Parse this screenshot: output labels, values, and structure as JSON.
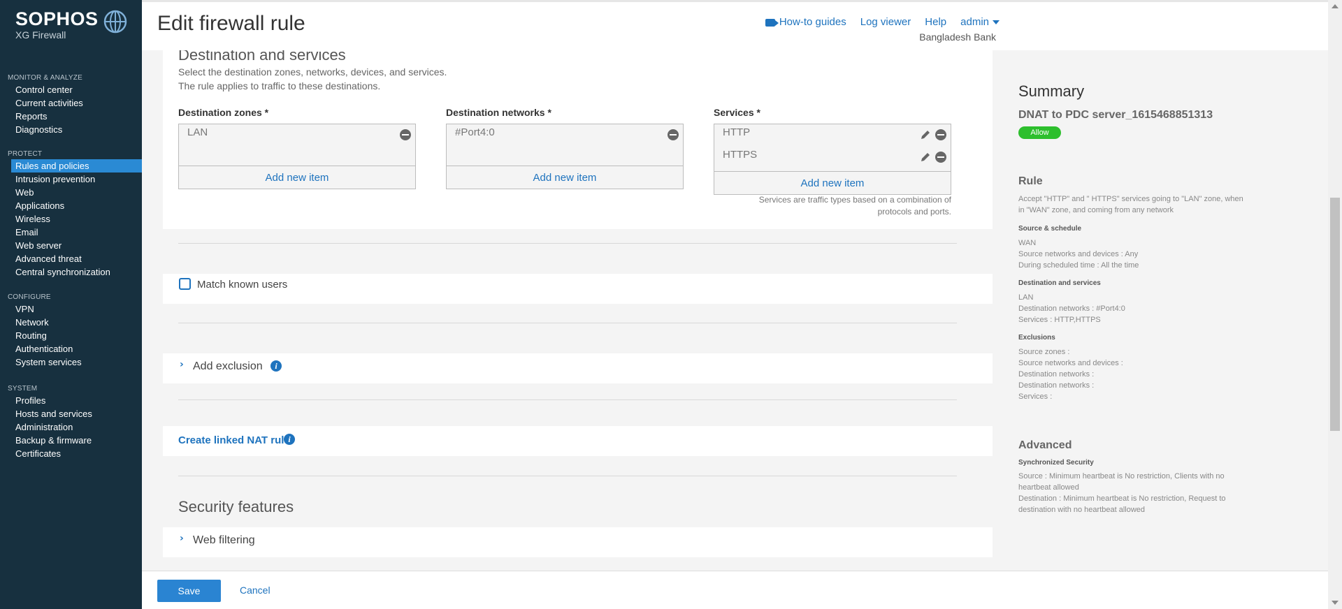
{
  "brand": {
    "name": "SOPHOS",
    "product": "XG Firewall"
  },
  "sidebar": {
    "sections": [
      {
        "heading": "MONITOR & ANALYZE",
        "items": [
          "Control center",
          "Current activities",
          "Reports",
          "Diagnostics"
        ]
      },
      {
        "heading": "PROTECT",
        "items": [
          "Rules and policies",
          "Intrusion prevention",
          "Web",
          "Applications",
          "Wireless",
          "Email",
          "Web server",
          "Advanced threat",
          "Central synchronization"
        ]
      },
      {
        "heading": "CONFIGURE",
        "items": [
          "VPN",
          "Network",
          "Routing",
          "Authentication",
          "System services"
        ]
      },
      {
        "heading": "SYSTEM",
        "items": [
          "Profiles",
          "Hosts and services",
          "Administration",
          "Backup & firmware",
          "Certificates"
        ]
      }
    ],
    "active_item": "Rules and policies"
  },
  "header": {
    "title": "Edit firewall rule",
    "links": {
      "howto": "How-to guides",
      "logviewer": "Log viewer",
      "help": "Help",
      "user": "admin"
    },
    "company": "Bangladesh Bank"
  },
  "destination": {
    "title": "Destination and services",
    "desc1": "Select the destination zones, networks, devices, and services.",
    "desc2": "The rule applies to traffic to these destinations.",
    "zones_label": "Destination zones *",
    "zones": [
      "LAN"
    ],
    "networks_label": "Destination networks *",
    "networks": [
      "#Port4:0"
    ],
    "services_label": "Services *",
    "services": [
      "HTTP",
      "HTTPS"
    ],
    "add_item": "Add new item",
    "services_hint_1": "Services are traffic types based on a combination of",
    "services_hint_2": "protocols and ports."
  },
  "match_known_users": {
    "label": "Match known users",
    "checked": false
  },
  "exclusion": {
    "label": "Add exclusion"
  },
  "linked_nat": {
    "label": "Create linked NAT rule"
  },
  "security": {
    "title": "Security features",
    "web_filtering": "Web filtering"
  },
  "footer": {
    "save": "Save",
    "cancel": "Cancel"
  },
  "summary": {
    "title": "Summary",
    "rule_name": "DNAT to PDC server_1615468851313",
    "action_badge": "Allow",
    "rule_heading": "Rule",
    "rule_desc": "Accept \"HTTP\" and \" HTTPS\" services going to \"LAN\" zone, when in \"WAN\" zone, and coming from any network",
    "source_heading": "Source & schedule",
    "source_lines": [
      "WAN",
      "Source networks and devices : Any",
      "During scheduled time : All the time"
    ],
    "dest_heading": "Destination and services",
    "dest_lines": [
      "LAN",
      "Destination networks : #Port4:0",
      "Services : HTTP,HTTPS"
    ],
    "excl_heading": "Exclusions",
    "excl_lines": [
      "Source zones :",
      "Source networks and devices :",
      "Destination networks :",
      "Destination networks :",
      "Services :"
    ],
    "advanced_heading": "Advanced",
    "sync_heading": "Synchronized Security",
    "sync_source": "Source : Minimum heartbeat is No restriction, Clients with no heartbeat allowed",
    "sync_dest": "Destination : Minimum heartbeat is No restriction, Request to destination with no heartbeat allowed"
  },
  "colors": {
    "sidebar_bg": "#17303f",
    "accent": "#1e73be",
    "active_nav": "#2a8ad4",
    "allow_badge": "#2dbf2d"
  }
}
